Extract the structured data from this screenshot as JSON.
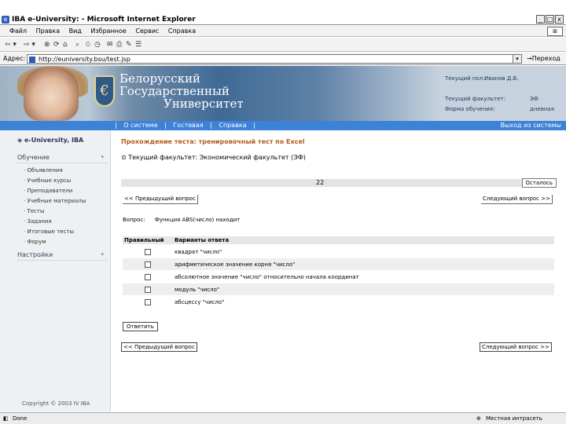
{
  "window": {
    "title": "IBA e-University: - Microsoft Internet Explorer",
    "ie_icon": "e",
    "min": "_",
    "max": "□",
    "close": "x"
  },
  "menu": [
    "Файл",
    "Правка",
    "Вид",
    "Избранное",
    "Сервис",
    "Справка"
  ],
  "toolbar": {
    "back": "⇦ ▾",
    "forward": "⇨ ▾",
    "stop": "⊗",
    "refresh": "⟳",
    "home": "⌂",
    "search": "⌕",
    "favorites": "✩",
    "history": "◷",
    "mail": "✉",
    "print": "⎙",
    "edit": "✎",
    "discuss": "☰"
  },
  "address": {
    "label": "Адрес:",
    "url": "http://euniversity.bsu/test.jsp",
    "go": "Переход"
  },
  "banner": {
    "university": [
      "Белорусский",
      "Государственный",
      "Университет"
    ],
    "user_label": "Текущий пол.:",
    "user_value": "Иванов Д.В.",
    "faculty_label": "Текущий факультет:",
    "faculty_value": "ЭФ",
    "form_label": "Форма обучения:",
    "form_value": "дневная"
  },
  "nav": {
    "links": [
      "О системе",
      "Гостевая",
      "Справка"
    ],
    "sep": "|",
    "exit": "Выход из системы"
  },
  "sidebar": {
    "logo": "e-University, IBA",
    "section1": "Обучение",
    "items": [
      "Объявления",
      "Учебные курсы",
      "Преподаватели",
      "Учебные материалы",
      "Тесты",
      "Задания",
      "Итоговые тесты",
      "Форум"
    ],
    "section2": "Настройки",
    "copyright": "Copyright © 2003 IV IBA"
  },
  "content": {
    "title": "Прохождение теста: тренировочный тест по Excel",
    "faculty": "Текущий факультет:  Экономический факультет (ЭФ)",
    "question_number": "22",
    "remaining": "Осталось",
    "prev": "<< Предыдущий вопрос",
    "next": "Следующий вопрос >>",
    "question_label": "Вопрос:",
    "question_text": "Функция ABS(число) находит",
    "col_correct": "Правильный",
    "col_answers": "Варианты ответа",
    "answers": [
      "квадрат \"число\"",
      "арифметическое значение корня \"число\"",
      "абсолютное значение \"число\" относительно начала координат",
      "модуль \"число\"",
      "абсцессу \"число\""
    ],
    "submit": "Ответить",
    "prev2": "<< Предыдущий вопрос",
    "next2": "Следующий вопрос >>"
  },
  "status": {
    "left": "Done",
    "right": "Местная интрасеть"
  }
}
